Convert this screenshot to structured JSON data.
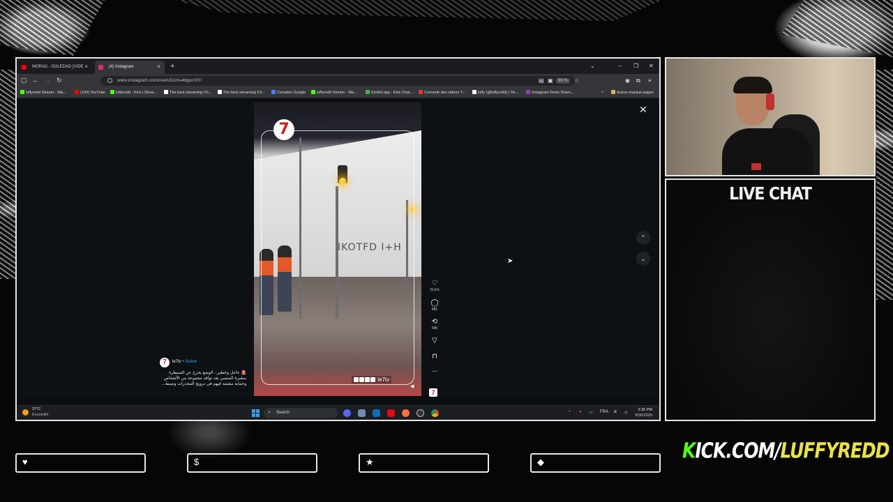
{
  "browser": {
    "tabs": [
      {
        "label": "MORAD - SOLEDAD [VIDE",
        "active": false,
        "icon": "youtube-icon",
        "color": "#ff0000"
      },
      {
        "label": "(4) Instagram",
        "active": true,
        "icon": "instagram-icon",
        "color": "#e1306c"
      }
    ],
    "new_tab": "+",
    "url": "www.instagram.com/reels/Dcmu4bgonSY/",
    "zoom": "90 %",
    "bookmarks": [
      {
        "label": "luffyredd Stream - Wa...",
        "color": "#53fc18"
      },
      {
        "label": "(100) YouTube",
        "color": "#ff0000"
      },
      {
        "label": "luffyredd - Kick | Strea...",
        "color": "#53fc18"
      },
      {
        "label": "The best streaming Ch...",
        "color": "#ffffff"
      },
      {
        "label": "The best streaming Ch...",
        "color": "#ffffff"
      },
      {
        "label": "Comptes Google",
        "color": "#4285f4"
      },
      {
        "label": "luffyredd Stream - Wa...",
        "color": "#53fc18"
      },
      {
        "label": "Kicklet.app - Kick Chat...",
        "color": "#4caf50"
      },
      {
        "label": "Convertir des vidéos Y...",
        "color": "#e53935"
      },
      {
        "label": "luffy (@luffyredd) | Tik...",
        "color": "#ffffff"
      },
      {
        "label": "Instagram Reels Down...",
        "color": "#8e44ad"
      }
    ],
    "bookmarks_more": "»",
    "other_bookmarks": "Autres marque-pages"
  },
  "reel": {
    "channel_logo": "7",
    "handle": "le7tv",
    "username": "le7tv",
    "follow": "Suivre",
    "caption": "🚨 عاجل وخطير.. الوضع يخرج عن السيطرة بمقبرة المنسي بعد توافد مجموعة من الأشخاص وحماية مشتبه فيهم في ترويج المخدرات وضبط...",
    "graffiti": "IKOTFD I+H",
    "likes": "21,6 k",
    "comments": "681",
    "reposts": "540",
    "more": "...",
    "brand": "7"
  },
  "taskbar": {
    "temp": "27°C",
    "weather": "Ensoleillé",
    "search_placeholder": "Search",
    "language": "FRA",
    "time": "2:35 PM",
    "date": "8/30/2026"
  },
  "overlay": {
    "chat_title": "LIVE CHAT",
    "kick_prefix": "KICK.COM/",
    "kick_handle": "LUFFYREDD",
    "social_boxes": [
      {
        "icon": "heart-icon",
        "label": ""
      },
      {
        "icon": "dollar-icon",
        "label": ""
      },
      {
        "icon": "star-icon",
        "label": ""
      },
      {
        "icon": "diamond-icon",
        "label": ""
      }
    ]
  },
  "colors": {
    "kick_green": "#53fc18",
    "kick_yellow": "#e8e14a",
    "instagram_red": "#c92020"
  }
}
